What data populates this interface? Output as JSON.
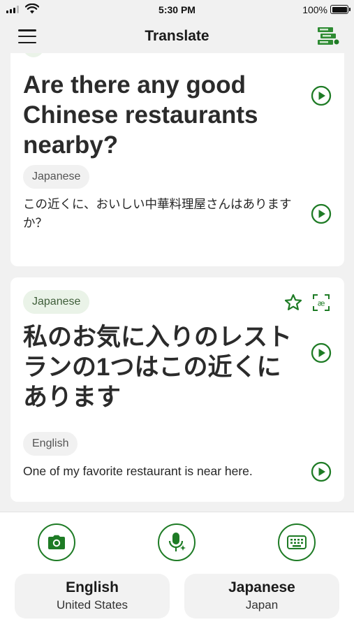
{
  "status": {
    "time": "5:30 PM",
    "battery": "100%"
  },
  "header": {
    "title": "Translate"
  },
  "cards": [
    {
      "source_text": "Are there any good Chinese restaurants nearby?",
      "target_lang": "Japanese",
      "target_text": "この近くに、おいしい中華料理屋さんはありますか？"
    },
    {
      "source_lang": "Japanese",
      "source_text": "私のお気に入りのレストランの1つはこの近くにあります",
      "target_lang": "English",
      "target_text": "One of my favorite restaurant is near here."
    }
  ],
  "languages": {
    "left": {
      "name": "English",
      "region": "United States"
    },
    "right": {
      "name": "Japanese",
      "region": "Japan"
    }
  },
  "colors": {
    "accent": "#1e7b25",
    "background": "#f1f1f1",
    "card": "#ffffff"
  },
  "icons": [
    "menu-icon",
    "phrasebook-icon",
    "play-icon",
    "star-icon",
    "transliteration-icon",
    "camera-icon",
    "microphone-icon",
    "keyboard-icon"
  ]
}
